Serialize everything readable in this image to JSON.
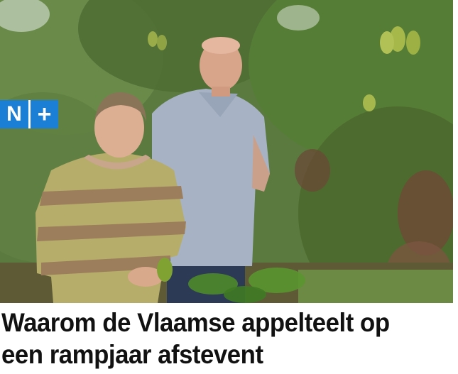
{
  "article": {
    "badge": {
      "letter": "N",
      "symbol": "+",
      "color": "#1c7fd6"
    },
    "photo": {
      "alt": ""
    },
    "headline": "Waarom de Vlaamse appelteelt op een rampjaar afstevent"
  }
}
